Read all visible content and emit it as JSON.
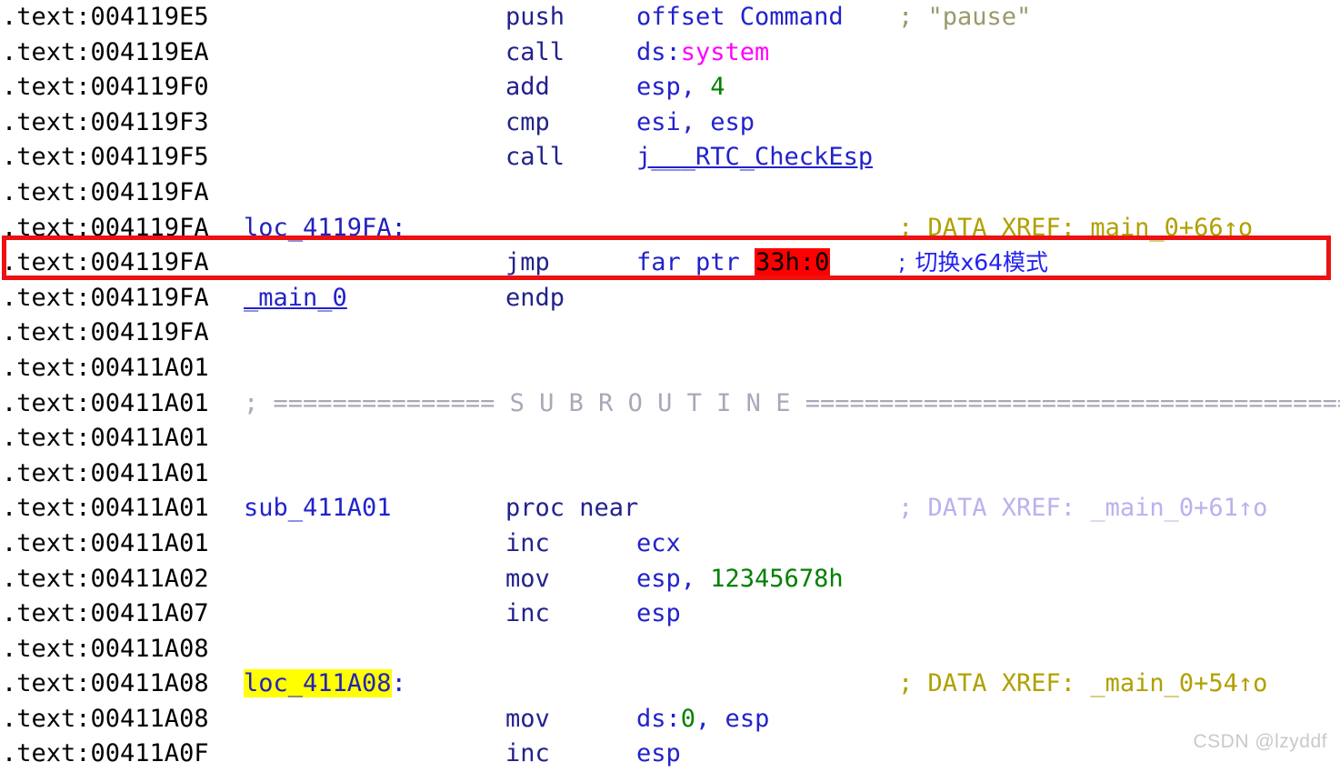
{
  "app": {
    "view": "IDA Pro disassembly listing",
    "segment": ".text"
  },
  "colors": {
    "address": "#000000",
    "mnemonic": "#22228c",
    "operand_register": "#2222cc",
    "number_constant": "#008000",
    "imported_function": "#ff00ff",
    "xref_name": "#2222cc",
    "string_comment": "#9a9a6a",
    "xref_comment_olive": "#b0a000",
    "xref_comment_lavender": "#b9b2ee",
    "separator_line": "#a8a8b8",
    "chinese_comment": "#2222ee",
    "highlight_red_bg": "#ff0000",
    "highlight_yellow_bg": "#ffff00",
    "emphasis_box_border": "#ee1111",
    "watermark": "#c9c9c9"
  },
  "lines": [
    {
      "address": ".text:004119E5",
      "label": "",
      "mnemonic": "push",
      "operand": "offset Command",
      "comment": "; \"pause\""
    },
    {
      "address": ".text:004119EA",
      "label": "",
      "mnemonic": "call",
      "operand": "ds:system",
      "comment": ""
    },
    {
      "address": ".text:004119F0",
      "label": "",
      "mnemonic": "add",
      "operand": "esp, 4",
      "comment": ""
    },
    {
      "address": ".text:004119F3",
      "label": "",
      "mnemonic": "cmp",
      "operand": "esi, esp",
      "comment": ""
    },
    {
      "address": ".text:004119F5",
      "label": "",
      "mnemonic": "call",
      "operand": "j___RTC_CheckEsp",
      "comment": ""
    },
    {
      "address": ".text:004119FA",
      "label": "",
      "mnemonic": "",
      "operand": "",
      "comment": ""
    },
    {
      "address": ".text:004119FA",
      "label": "loc_4119FA:",
      "mnemonic": "",
      "operand": "",
      "comment": "; DATA XREF: main_0+66↑o"
    },
    {
      "address": ".text:004119FA",
      "label": "",
      "mnemonic": "jmp",
      "operand": "far ptr 33h:0",
      "operand_prefix": "far ptr ",
      "operand_highlight": "33h:0",
      "comment": "; 切换x64模式",
      "comment_semicolon": ";",
      "comment_text": "切换x64模式",
      "emphasized": true
    },
    {
      "address": ".text:004119FA",
      "label": "_main_0",
      "mnemonic": "endp",
      "operand": "",
      "comment": ""
    },
    {
      "address": ".text:004119FA",
      "label": "",
      "mnemonic": "",
      "operand": "",
      "comment": ""
    },
    {
      "address": ".text:00411A01",
      "label": "",
      "mnemonic": "",
      "operand": "",
      "comment": ""
    },
    {
      "address": ".text:00411A01",
      "label": "",
      "mnemonic": "",
      "operand": "",
      "comment": "",
      "separator": "; =============== S U B R O U T I N E ======================================="
    },
    {
      "address": ".text:00411A01",
      "label": "",
      "mnemonic": "",
      "operand": "",
      "comment": ""
    },
    {
      "address": ".text:00411A01",
      "label": "",
      "mnemonic": "",
      "operand": "",
      "comment": ""
    },
    {
      "address": ".text:00411A01",
      "label": "sub_411A01",
      "mnemonic": "proc near",
      "operand": "",
      "comment": "; DATA XREF: _main_0+61↑o"
    },
    {
      "address": ".text:00411A01",
      "label": "",
      "mnemonic": "inc",
      "operand": "ecx",
      "comment": ""
    },
    {
      "address": ".text:00411A02",
      "label": "",
      "mnemonic": "mov",
      "operand": "esp, 12345678h",
      "comment": ""
    },
    {
      "address": ".text:00411A07",
      "label": "",
      "mnemonic": "inc",
      "operand": "esp",
      "comment": ""
    },
    {
      "address": ".text:00411A08",
      "label": "",
      "mnemonic": "",
      "operand": "",
      "comment": ""
    },
    {
      "address": ".text:00411A08",
      "label": "loc_411A08:",
      "label_highlight": "loc_411A08",
      "mnemonic": "",
      "operand": "",
      "comment": "; DATA XREF: _main_0+54↑o"
    },
    {
      "address": ".text:00411A08",
      "label": "",
      "mnemonic": "mov",
      "operand": "ds:0, esp",
      "comment": ""
    },
    {
      "address": ".text:00411A0F",
      "label": "",
      "mnemonic": "inc",
      "operand": "esp",
      "comment": ""
    }
  ],
  "watermark": "CSDN @lzyddf"
}
